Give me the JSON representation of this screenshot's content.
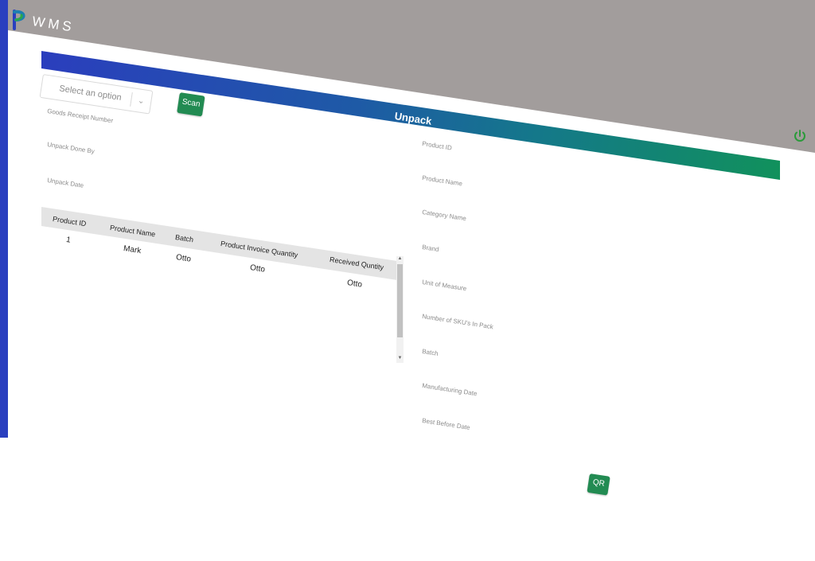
{
  "app": {
    "title": "WMS",
    "brand_color": "#2a3fbf",
    "accent_color": "#228b52",
    "logo_icon": "p-logo-icon",
    "power_icon": "power-icon"
  },
  "banner": {
    "title": "Unpack"
  },
  "form": {
    "select_placeholder": "Select an option",
    "scan_label": "Scan",
    "goods_receipt_label": "Goods Receipt Number",
    "unpack_done_by_label": "Unpack Done By",
    "unpack_date_label": "Unpack Date",
    "qr_label": "QR"
  },
  "details": {
    "product_id": "Product ID",
    "product_name": "Product Name",
    "category_name": "Category Name",
    "brand": "Brand",
    "unit_of_measure": "Unit of Measure",
    "skus_in_pack": "Number of SKU's In Pack",
    "batch": "Batch",
    "manufacturing_date": "Manufacturing Date",
    "best_before_date": "Best Before Date"
  },
  "table": {
    "headers": [
      "Product ID",
      "Product Name",
      "Batch",
      "Product Invoice Quantity",
      "Received Quntity"
    ],
    "rows": [
      [
        "1",
        "Mark",
        "Otto",
        "Otto",
        "Otto"
      ]
    ]
  }
}
